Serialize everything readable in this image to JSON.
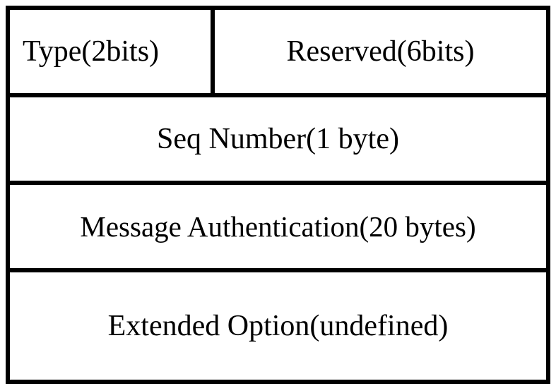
{
  "packet": {
    "row0": {
      "type": "Type(2bits)",
      "reserved": "Reserved(6bits)"
    },
    "row1": {
      "seq": "Seq Number(1 byte)"
    },
    "row2": {
      "mac": "Message Authentication(20 bytes)"
    },
    "row3": {
      "ext": "Extended Option(undefined)"
    }
  }
}
